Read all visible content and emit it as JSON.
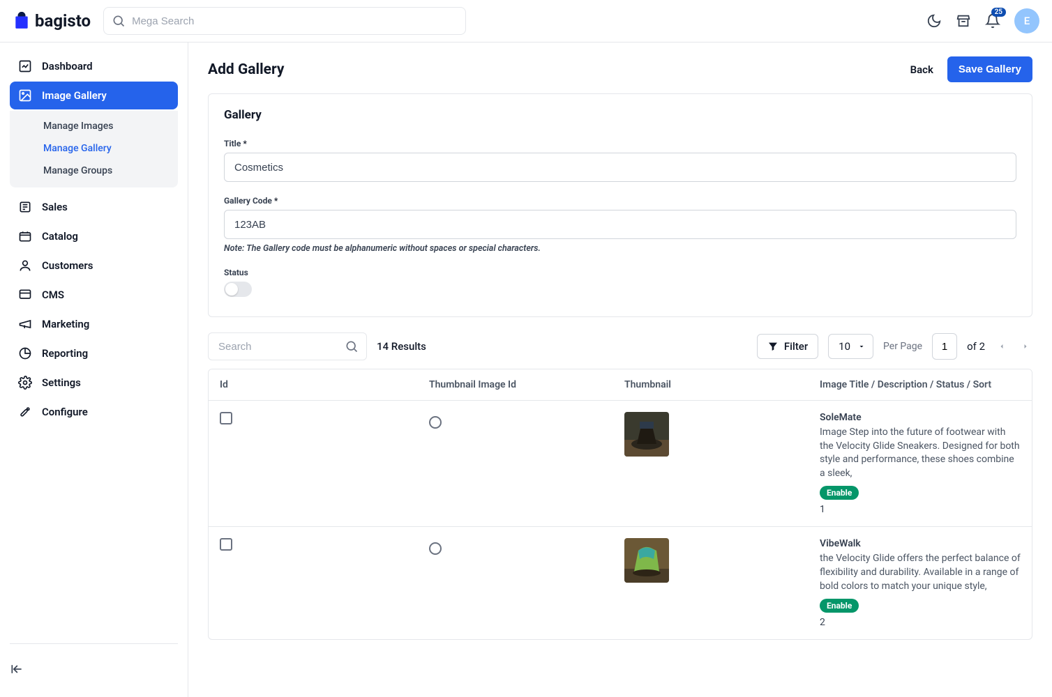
{
  "brand": {
    "name": "bagisto",
    "avatar_initial": "E"
  },
  "search": {
    "placeholder": "Mega Search"
  },
  "notifications": {
    "count": "25"
  },
  "sidebar": {
    "items": [
      {
        "label": "Dashboard"
      },
      {
        "label": "Image Gallery"
      },
      {
        "label": "Sales"
      },
      {
        "label": "Catalog"
      },
      {
        "label": "Customers"
      },
      {
        "label": "CMS"
      },
      {
        "label": "Marketing"
      },
      {
        "label": "Reporting"
      },
      {
        "label": "Settings"
      },
      {
        "label": "Configure"
      }
    ],
    "sub": [
      {
        "label": "Manage Images"
      },
      {
        "label": "Manage Gallery"
      },
      {
        "label": "Manage Groups"
      }
    ]
  },
  "page": {
    "title": "Add Gallery",
    "back": "Back",
    "save": "Save Gallery"
  },
  "form": {
    "section_title": "Gallery",
    "title_label": "Title",
    "title_value": "Cosmetics",
    "code_label": "Gallery Code",
    "code_value": "123AB",
    "code_note": "Note: The Gallery code must be alphanumeric without spaces or special characters.",
    "status_label": "Status"
  },
  "toolbar": {
    "search_placeholder": "Search",
    "results": "14 Results",
    "filter": "Filter",
    "page_size": "10",
    "per_page": "Per Page",
    "page": "1",
    "of": "of 2"
  },
  "table": {
    "headers": {
      "id": "Id",
      "thumb_id": "Thumbnail Image Id",
      "thumb": "Thumbnail",
      "meta": "Image Title / Description / Status / Sort"
    },
    "rows": [
      {
        "title": "SoleMate",
        "desc": "Image Step into the future of footwear with the Velocity Glide Sneakers. Designed for both style and performance, these shoes combine a sleek,",
        "status": "Enable",
        "sort": "1"
      },
      {
        "title": "VibeWalk",
        "desc": "the Velocity Glide offers the perfect balance of flexibility and durability. Available in a range of bold colors to match your unique style,",
        "status": "Enable",
        "sort": "2"
      }
    ]
  }
}
